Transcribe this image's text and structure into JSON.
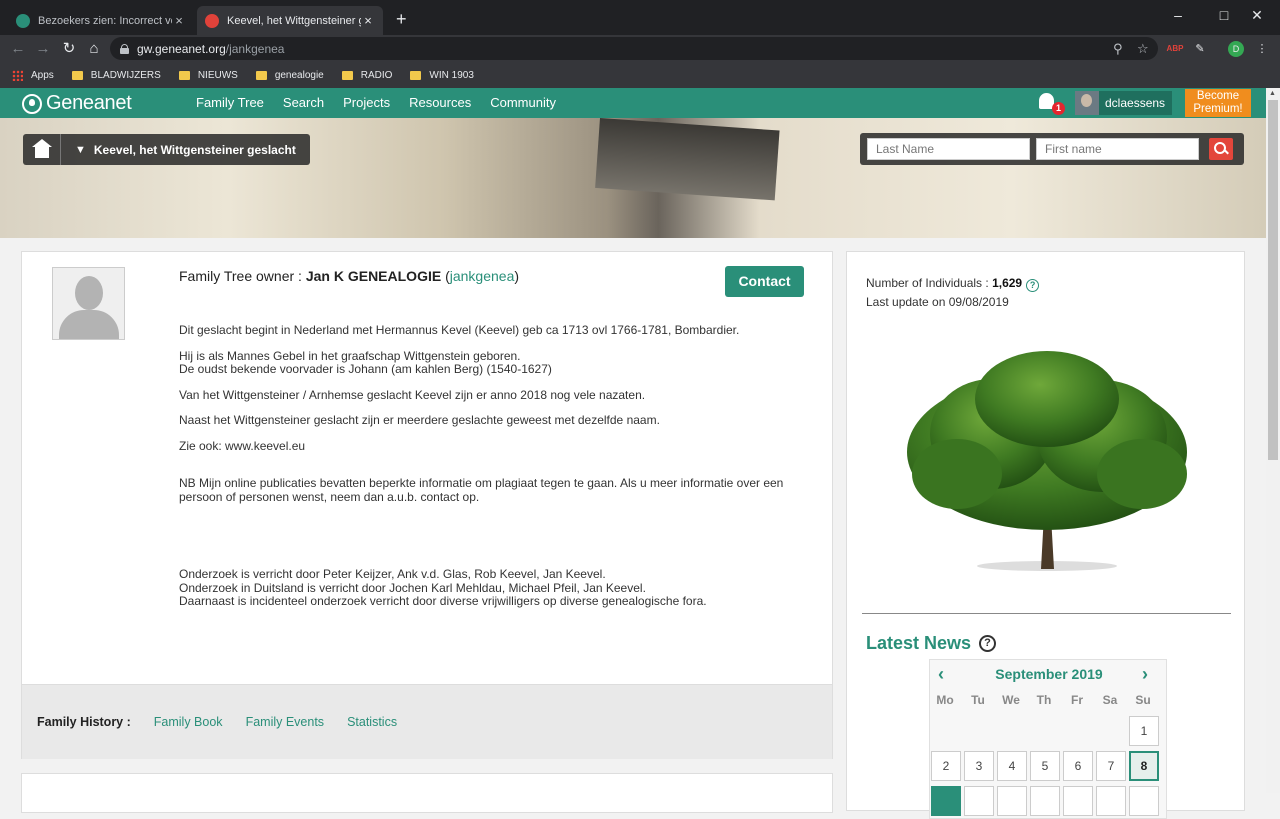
{
  "browser": {
    "tabs": [
      {
        "title": "Bezoekers zien: Incorrect verzoek",
        "close": "×"
      },
      {
        "title": "Keevel, het Wittgensteiner geslacht",
        "close": "×"
      }
    ],
    "new_tab": "+",
    "url_host": "gw.geneanet.org",
    "url_path": "/jankgenea",
    "bookmarks": [
      "Apps",
      "BLADWIJZERS",
      "NIEUWS",
      "genealogie",
      "RADIO",
      "WIN 1903"
    ],
    "profile_initial": "D",
    "ext_badge": "ABP"
  },
  "site": {
    "logo": "Geneanet",
    "menu": [
      "Family Tree",
      "Search",
      "Projects",
      "Resources",
      "Community"
    ],
    "notifications_count": "1",
    "username": "dclaessens",
    "premium_label": "Become Premium!",
    "breadcrumb": "Keevel, het Wittgensteiner geslacht",
    "search": {
      "last_name_placeholder": "Last Name",
      "first_name_placeholder": "First name"
    }
  },
  "owner": {
    "prefix": "Family Tree owner : ",
    "name": "Jan K GENEALOGIE",
    "login": "jankgenea",
    "contact_label": "Contact"
  },
  "description": [
    "Dit geslacht begint in Nederland met Hermannus Kevel (Keevel) geb ca 1713 ovl 1766-1781, Bombardier.",
    "Hij is als Mannes Gebel in het graafschap Wittgenstein geboren.",
    "De oudst bekende voorvader is Johann (am kahlen Berg) (1540-1627)",
    "Van het Wittgensteiner / Arnhemse geslacht Keevel zijn er anno 2018 nog vele nazaten.",
    "Naast het Wittgensteiner geslacht zijn er meerdere geslachte geweest met dezelfde naam.",
    "Zie ook: www.keevel.eu",
    "NB Mijn online publicaties bevatten beperkte informatie om plagiaat tegen te gaan. Als u meer informatie over een persoon of personen wenst, neem dan a.u.b. contact op.",
    "Onderzoek is verricht door Peter Keijzer, Ank v.d. Glas, Rob Keevel, Jan Keevel.",
    "Onderzoek in Duitsland is verricht door Jochen Karl Mehldau, Michael Pfeil, Jan Keevel.",
    "Daarnaast is incidenteel onderzoek verricht door diverse vrijwilligers op diverse genealogische fora."
  ],
  "history": {
    "label": "Family History :",
    "links": [
      "Family Book",
      "Family Events",
      "Statistics"
    ]
  },
  "stats": {
    "individuals_label": "Number of Individuals : ",
    "individuals_value": "1,629",
    "last_update": "Last update on 09/08/2019"
  },
  "news": {
    "title": "Latest News",
    "month": "September 2019",
    "weekdays": [
      "Mo",
      "Tu",
      "We",
      "Th",
      "Fr",
      "Sa",
      "Su"
    ],
    "days": [
      "1",
      "2",
      "3",
      "4",
      "5",
      "6",
      "7",
      "8"
    ],
    "today": "8"
  },
  "colors": {
    "brand": "#2a8f79",
    "premium": "#f08d1e",
    "search_button": "#e3463b"
  }
}
